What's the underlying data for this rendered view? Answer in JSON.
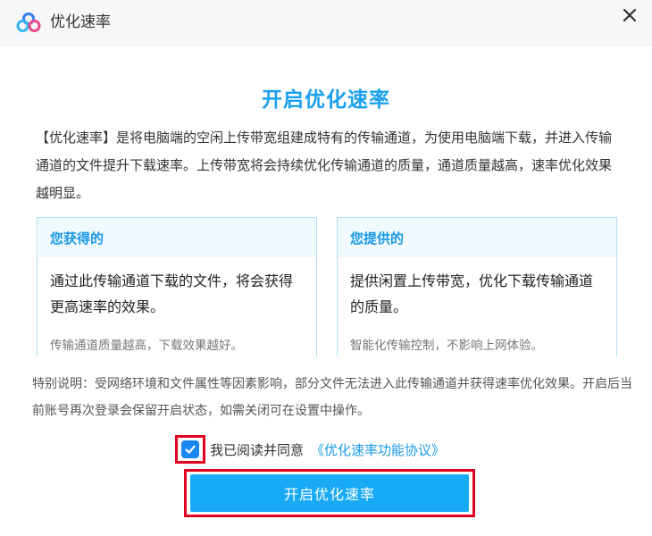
{
  "window": {
    "title": "优化速率",
    "logo_icon": "cloud-logo-icon",
    "close_icon": "close-icon"
  },
  "main": {
    "title": "开启优化速率",
    "intro": "【优化速率】是将电脑端的空闲上传带宽组建成特有的传输通道，为使用电脑端下载，并进入传输通道的文件提升下载速率。上传带宽将会持续优化传输通道的质量，通道质量越高，速率优化效果越明显。"
  },
  "panels": [
    {
      "heading": "您获得的",
      "body": "通过此传输通道下载的文件，将会获得更高速率的效果。",
      "footnote": "传输通道质量越高，下载效果越好。"
    },
    {
      "heading": "您提供的",
      "body": "提供闲置上传带宽，优化下载传输通道的质量。",
      "footnote": "智能化传输控制，不影响上网体验。"
    }
  ],
  "note": "特别说明：受网络环境和文件属性等因素影响，部分文件无法进入此传输通道并获得速率优化效果。开启后当前账号再次登录会保留开启状态，如需关闭可在设置中操作。",
  "agreement": {
    "checked": true,
    "text": "我已阅读并同意",
    "link": "《优化速率功能协议》"
  },
  "primary_button": "开启优化速率",
  "colors": {
    "accent": "#1aa0ef",
    "button": "#19aaf5",
    "highlight_frame": "#e0001f",
    "panel_border": "#aee0f6"
  }
}
